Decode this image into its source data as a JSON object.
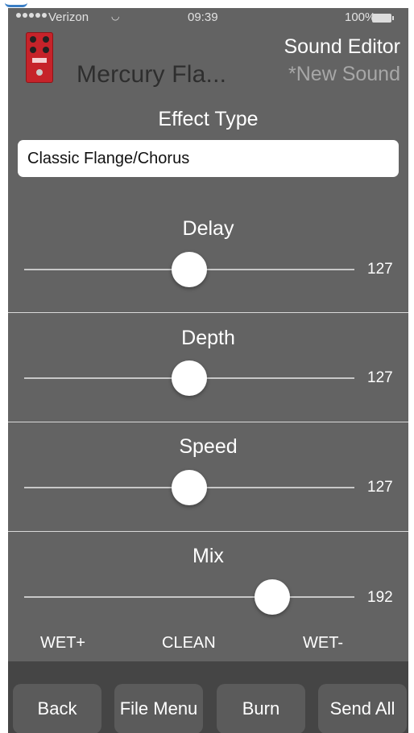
{
  "status_bar": {
    "carrier": "Verizon",
    "time": "09:39",
    "battery": "100%"
  },
  "header": {
    "device_name": "Mercury Fla...",
    "editor_title": "Sound Editor",
    "sound_name": "*New Sound"
  },
  "effect": {
    "label": "Effect Type",
    "value": "Classic Flange/Chorus"
  },
  "parameters": [
    {
      "name": "Delay",
      "value": "127",
      "level": 0.5
    },
    {
      "name": "Depth",
      "value": "127",
      "level": 0.5
    },
    {
      "name": "Speed",
      "value": "127",
      "level": 0.5
    },
    {
      "name": "Mix",
      "value": "192",
      "level": 0.75
    }
  ],
  "mix_labels": {
    "left": "WET+",
    "center": "CLEAN",
    "right": "WET-"
  },
  "toolbar": {
    "back": "Back",
    "file_menu": "File Menu",
    "burn": "Burn",
    "send_all": "Send All"
  },
  "colors": {
    "background": "#636363",
    "toolbar": "#454545",
    "accent": "#c6232a"
  }
}
